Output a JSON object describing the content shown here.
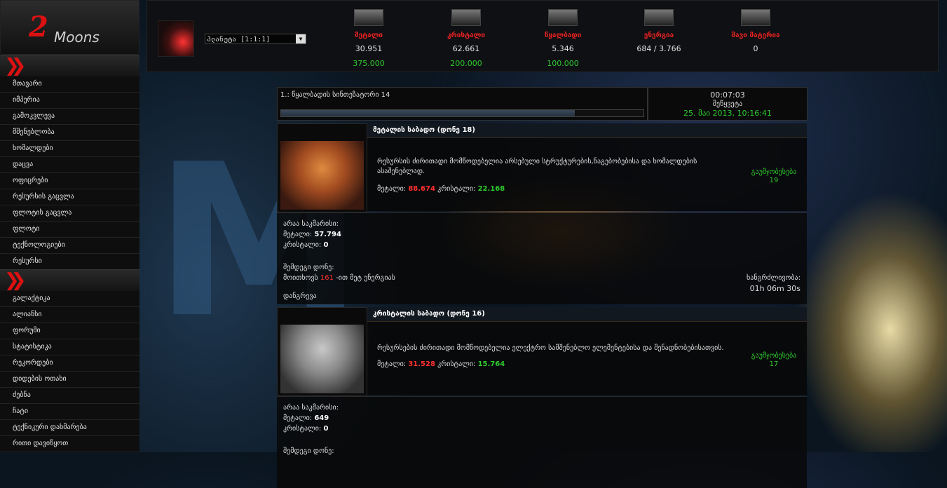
{
  "logo": {
    "number": "2",
    "text": "Moons"
  },
  "menu1": [
    "მთავარი",
    "იმპერია",
    "გამოკვლევა",
    "მშენებლობა",
    "ხომალდები",
    "დაცვა",
    "ოფიცრები",
    "რესურსის გაცვლა",
    "ფლოტის გაცვლა",
    "ფლოტი",
    "ტექნოლოგიები",
    "რესურსი"
  ],
  "menu2": [
    "გალაქტიკა",
    "ალიანსი",
    "ფორუმი",
    "სტატისტიკა",
    "რეკორდები",
    "დიდების ოთახი",
    "ძებნა",
    "ჩატი",
    "ტექნიკური დახმარება",
    "რითი დავიწყოთ"
  ],
  "header": {
    "planet_select": "პლანეტა [1:1:1]",
    "resources": [
      {
        "name": "მეტალი",
        "value": "30.951",
        "production": "375.000"
      },
      {
        "name": "კრისტალი",
        "value": "62.661",
        "production": "200.000"
      },
      {
        "name": "წყალბადი",
        "value": "5.346",
        "production": "100.000"
      },
      {
        "name": "ენერგია",
        "value": "684 / 3.766",
        "production": ""
      },
      {
        "name": "შავი მატერია",
        "value": "0",
        "production": ""
      }
    ]
  },
  "queue": {
    "item": "1.: წყალბადის სინთეზატორი 14",
    "progress": 0.81,
    "time_left": "00:07:03",
    "cancel": "შეწყვეტა",
    "finish": "25. მაი 2013, 10:16:41"
  },
  "buildings": [
    {
      "name": "მეტალის საბადო (დონე 18)",
      "description": "რესურსის ძირითადი მომწოდებელია არსებული სტრუქტურების,ნაგებობებისა და ხომალდების ასაშენებლად.",
      "cost_metal_label": "მეტალი:",
      "cost_metal": "88.674",
      "cost_crystal_label": "კრისტალი:",
      "cost_crystal": "22.168",
      "upgrade_label": "გაუმჯობესება",
      "upgrade_level": "19",
      "missing_label": "არაა საკმარისი:",
      "missing_metal": "57.794",
      "missing_crystal": "0",
      "next_level_label": "შემდეგი დონე:",
      "next_needs_prefix": "მოითხოვს",
      "next_energy": "161",
      "next_needs_suffix": "-ით მეტ ენერგიას",
      "duration_label": "ხანგრძლივობა:",
      "duration": "01h 06m 30s",
      "demolish": "დანგრევა"
    },
    {
      "name": "კრისტალის საბადო (დონე 16)",
      "description": "რესურსების ძირითადი მომწოდებელია ელექტრო სამშენებლო ელემენტებისა და შენადნობებისათვის.",
      "cost_metal_label": "მეტალი:",
      "cost_metal": "31.528",
      "cost_crystal_label": "კრისტალი:",
      "cost_crystal": "15.764",
      "upgrade_label": "გაუმჯობესება",
      "upgrade_level": "17",
      "missing_label": "არაა საკმარისი:",
      "missing_metal": "649",
      "missing_crystal": "0",
      "next_level_label": "შემდეგი დონე:"
    }
  ],
  "labels": {
    "metal": "მეტალი:",
    "crystal": "კრისტალი:"
  }
}
